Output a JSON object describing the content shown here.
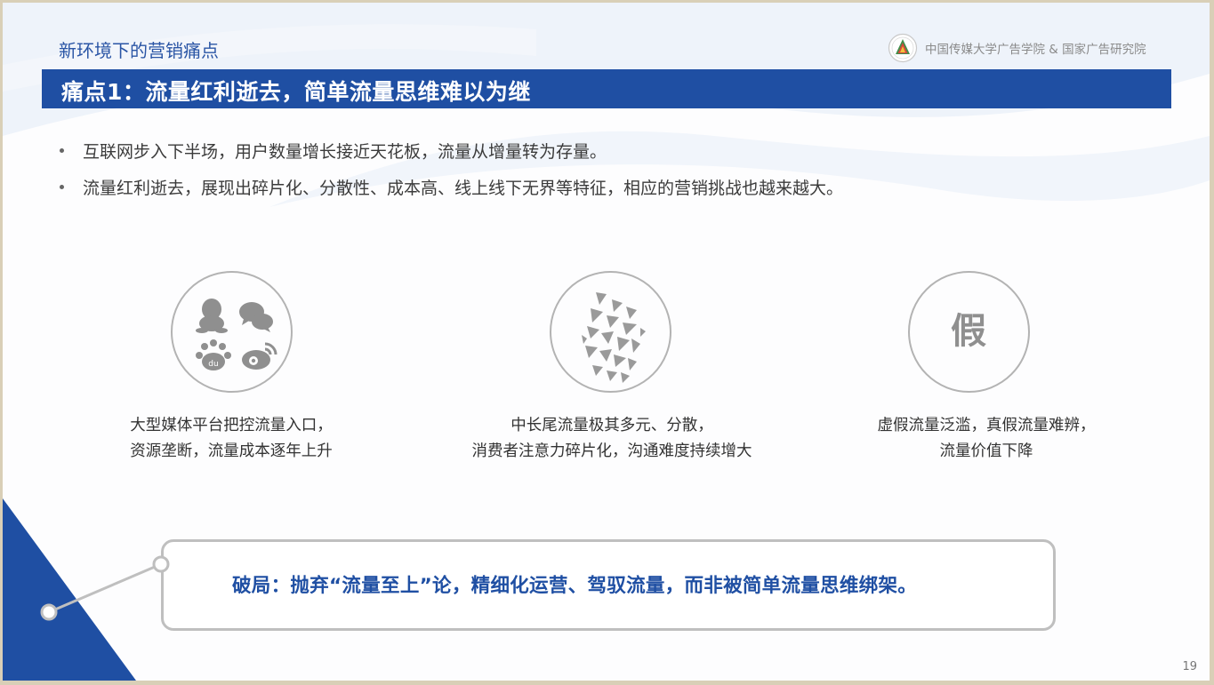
{
  "header": {
    "section_title": "新环境下的营销痛点",
    "org_name": "中国传媒大学广告学院 & 国家广告研究院",
    "logo_icon": "university-seal-icon"
  },
  "banner": {
    "title": "痛点1：流量红利逝去，简单流量思维难以为继"
  },
  "bullets": [
    "互联网步入下半场，用户数量增长接近天花板，流量从增量转为存量。",
    "流量红利逝去，展现出碎片化、分散性、成本高、线上线下无界等特征，相应的营销挑战也越来越大。"
  ],
  "cards": [
    {
      "icon": "social-media-platforms-icon",
      "caption_line1": "大型媒体平台把控流量入口，",
      "caption_line2": "资源垄断，流量成本逐年上升"
    },
    {
      "icon": "fragmented-triangles-icon",
      "caption_line1": "中长尾流量极其多元、分散，",
      "caption_line2": "消费者注意力碎片化，沟通难度持续增大"
    },
    {
      "icon": "fake-character-icon",
      "icon_text": "假",
      "caption_line1": "虚假流量泛滥，真假流量难辨，",
      "caption_line2": "流量价值下降"
    }
  ],
  "callout": {
    "text": "破局：抛弃“流量至上”论，精细化运营、驾驭流量，而非被简单流量思维绑架。"
  },
  "page_number": "19",
  "colors": {
    "brand_blue": "#1f4fa3",
    "title_blue": "#2a55a5",
    "icon_gray": "#8f8f8f",
    "border_gray": "#bfbfbf"
  }
}
